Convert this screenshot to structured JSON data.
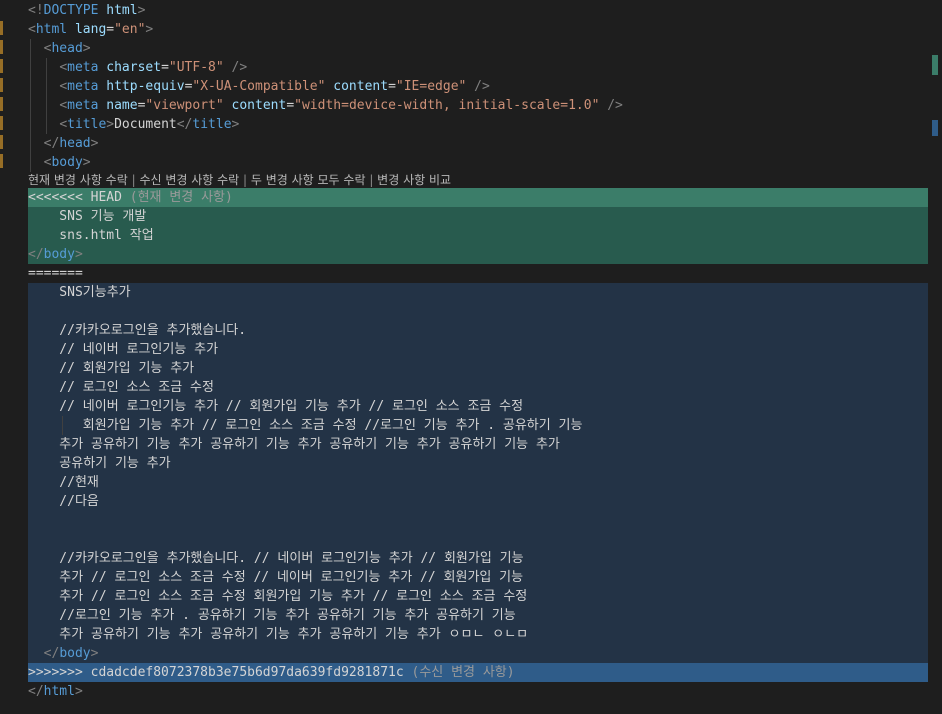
{
  "code": {
    "doctype_open": "<!",
    "doctype_kw": "DOCTYPE",
    "doctype_val": "html",
    "doctype_close": ">",
    "html_tag": "html",
    "lang_attr": "lang",
    "lang_val": "\"en\"",
    "head_tag": "head",
    "meta_tag": "meta",
    "charset_attr": "charset",
    "charset_val": "\"UTF-8\"",
    "http_equiv_attr": "http-equiv",
    "http_equiv_val": "\"X-UA-Compatible\"",
    "content_attr": "content",
    "content_val_ie": "\"IE=edge\"",
    "name_attr": "name",
    "name_val": "\"viewport\"",
    "content_val_viewport": "\"width=device-width, initial-scale=1.0\"",
    "self_close": " />",
    "title_tag": "title",
    "title_text": "Document",
    "body_tag": "body"
  },
  "codelens": {
    "accept_current": "현재 변경 사항 수락",
    "accept_incoming": "수신 변경 사항 수락",
    "accept_both": "두 변경 사항 모두 수락",
    "compare": "변경 사항 비교",
    "separator": " | "
  },
  "conflict": {
    "head_marker": "<<<<<<< HEAD",
    "head_label": "(현재 변경 사항)",
    "current_lines": [
      "    SNS 기능 개발",
      "    sns.html 작업"
    ],
    "divider": "=======",
    "incoming_lines": [
      "    SNS기능추가",
      "",
      "    //카카오로그인을 추가했습니다.",
      "    // 네이버 로그인기능 추가",
      "    // 회원가입 기능 추가",
      "    // 로그인 소스 조금 수정",
      "    // 네이버 로그인기능 추가 // 회원가입 기능 추가 // 로그인 소스 조금 수정",
      "       회원가입 기능 추가 // 로그인 소스 조금 수정 //로그인 기능 추가 . 공유하기 기능",
      "    추가 공유하기 기능 추가 공유하기 기능 추가 공유하기 기능 추가 공유하기 기능 추가",
      "    공유하기 기능 추가",
      "    //현재",
      "    //다음",
      "",
      "",
      "    //카카오로그인을 추가했습니다. // 네이버 로그인기능 추가 // 회원가입 기능",
      "    추가 // 로그인 소스 조금 수정 // 네이버 로그인기능 추가 // 회원가입 기능",
      "    추가 // 로그인 소스 조금 수정 회원가입 기능 추가 // 로그인 소스 조금 수정",
      "    //로그인 기능 추가 . 공유하기 기능 추가 공유하기 기능 추가 공유하기 기능",
      "    추가 공유하기 기능 추가 공유하기 기능 추가 공유하기 기능 추가 ㅇㅁㄴ ㅇㄴㅁ"
    ],
    "incoming_marker": ">>>>>>> cdadcdef8072378b3e75b6d97da639fd9281871c",
    "incoming_label": "(수신 변경 사항)"
  },
  "colors": {
    "current_bg": "#285b4e",
    "current_header_bg": "#3b7d69",
    "incoming_bg": "#233346",
    "incoming_header_bg": "#2f5c89",
    "tag": "#569cd6",
    "attribute": "#9cdcfe",
    "string": "#ce9178"
  }
}
